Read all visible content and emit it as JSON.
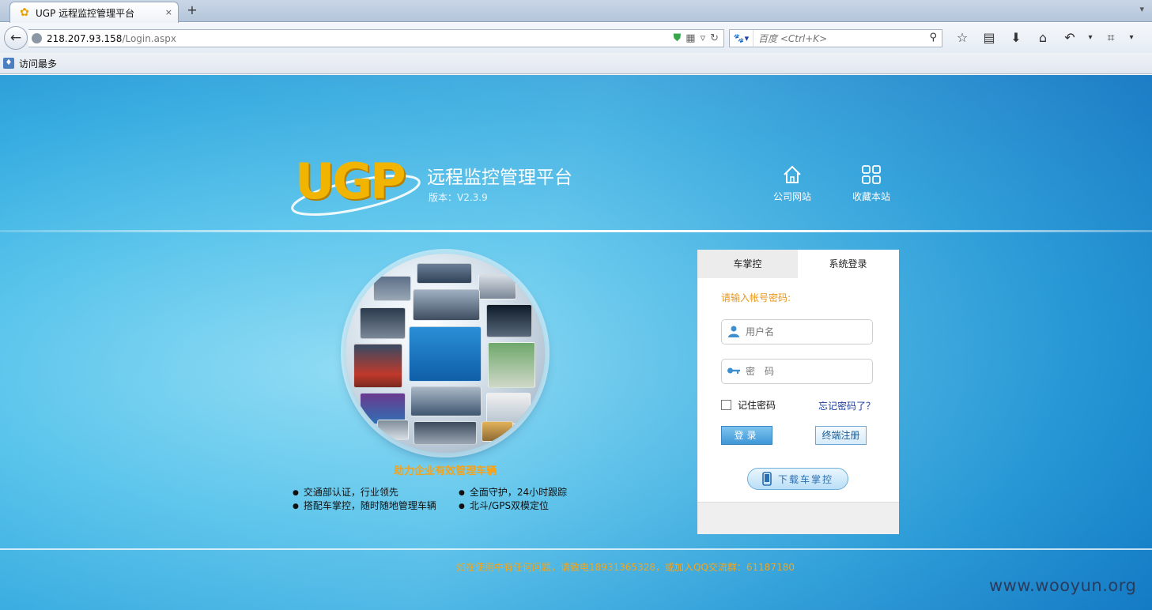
{
  "browser": {
    "tab_title": "UGP 远程监控管理平台",
    "tab_close": "×",
    "new_tab": "+",
    "url_host": "218.207.93.158",
    "url_path": "/Login.aspx",
    "search_placeholder": "百度 <Ctrl+K>",
    "search_engine_icon": "baidu-paw-icon",
    "bookmark_label": "访问最多",
    "toolbar_icons": [
      "bookmark-star-icon",
      "reading-list-icon",
      "download-icon",
      "home-icon",
      "undo-icon",
      "dropdown-icon",
      "crop-icon",
      "dropdown-icon"
    ]
  },
  "header": {
    "logo_text": "UGP",
    "title": "远程监控管理平台",
    "version": "版本：V2.3.9",
    "links": [
      {
        "label": "公司网站",
        "icon": "home-icon"
      },
      {
        "label": "收藏本站",
        "icon": "grid-icon"
      }
    ]
  },
  "promo": {
    "slogan": "助力企业有效管理车辆",
    "features": [
      "交通部认证，行业领先",
      "全面守护，24小时跟踪",
      "搭配车掌控，随时随地管理车辆",
      "北斗/GPS双模定位"
    ]
  },
  "login": {
    "tabs": [
      "车掌控",
      "系统登录"
    ],
    "active_tab": "系统登录",
    "prompt": "请输入帐号密码:",
    "username_placeholder": "用户名",
    "password_placeholder": "密　码",
    "remember_label": "记住密码",
    "remember_checked": false,
    "forgot_label": "忘记密码了？",
    "login_button": "登录",
    "register_button": "终端注册",
    "download_button": "下载车掌控"
  },
  "footer": {
    "contact": "如在使用中有任何问题，请致电18931365328，或加入QQ交流群：61187180"
  },
  "watermark": "www.wooyun.org",
  "colors": {
    "accent_orange": "#f5a21a",
    "login_blue": "#3e97d6",
    "background_blue": "#22a3dd",
    "link_blue": "#1b3e9b"
  }
}
